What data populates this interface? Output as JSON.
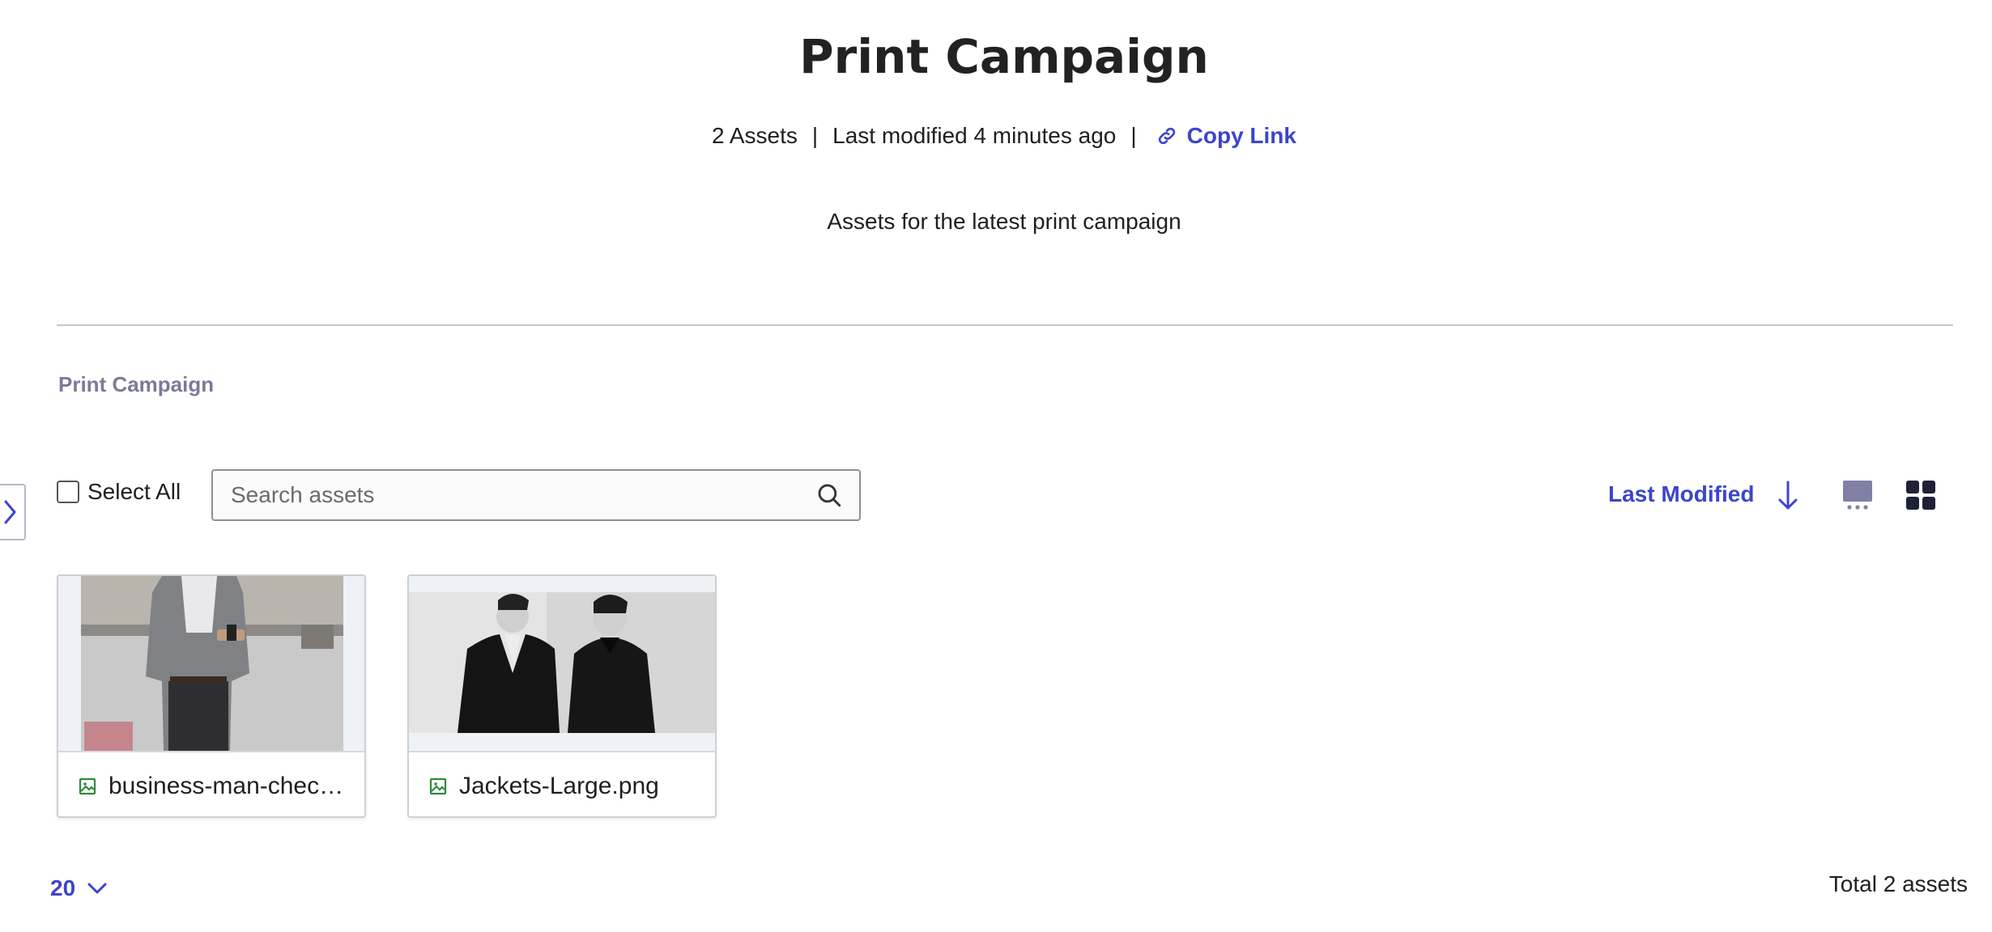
{
  "header": {
    "title": "Print Campaign",
    "asset_count": "2 Assets",
    "separator": "|",
    "last_modified": "Last modified 4 minutes ago",
    "copy_link": "Copy Link",
    "description": "Assets for the latest print campaign"
  },
  "breadcrumb": "Print Campaign",
  "toolbar": {
    "select_all": "Select All",
    "search_placeholder": "Search assets",
    "sort_label": "Last Modified",
    "sort_direction": "descending"
  },
  "assets": [
    {
      "name": "business-man-checks...",
      "type": "image"
    },
    {
      "name": "Jackets-Large.png",
      "type": "image"
    }
  ],
  "footer": {
    "page_size": "20",
    "total": "Total 2 assets"
  },
  "colors": {
    "accent": "#3d45c9",
    "muted_heading": "#7a7a9a",
    "image_icon": "#2e8a3a"
  }
}
